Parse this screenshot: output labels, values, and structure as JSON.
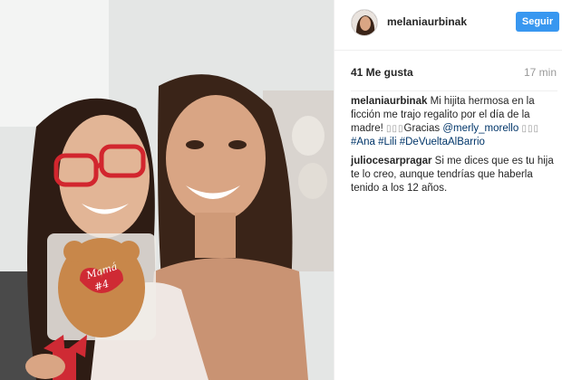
{
  "header": {
    "username": "melaniaurbinak",
    "follow_label": "Seguir"
  },
  "stats": {
    "likes": "41 Me gusta",
    "time": "17 min"
  },
  "photo": {
    "cookie_text": "Mamá",
    "cookie_number": "#4"
  },
  "comments": [
    {
      "author": "melaniaurbinak",
      "parts": [
        {
          "type": "text",
          "value": " Mi hijita hermosa en la ficción me trajo regalito por el día de la madre! "
        },
        {
          "type": "boxes",
          "value": "▯▯▯"
        },
        {
          "type": "text",
          "value": "Gracias "
        },
        {
          "type": "mention",
          "value": "@merly_morello"
        },
        {
          "type": "text",
          "value": " "
        },
        {
          "type": "boxes",
          "value": "▯▯▯"
        },
        {
          "type": "text",
          "value": " "
        },
        {
          "type": "tag",
          "value": "#Ana"
        },
        {
          "type": "text",
          "value": " "
        },
        {
          "type": "tag",
          "value": "#Lili"
        },
        {
          "type": "text",
          "value": " "
        },
        {
          "type": "tag",
          "value": "#DeVueltaAlBarrio"
        }
      ]
    },
    {
      "author": "juliocesarpragar",
      "parts": [
        {
          "type": "text",
          "value": " Si me dices que es tu hija te lo creo, aunque tendrías que haberla tenido a los 12 años."
        }
      ]
    }
  ],
  "colors": {
    "follow_button": "#3897f0",
    "link": "#003569",
    "muted": "#999999"
  }
}
